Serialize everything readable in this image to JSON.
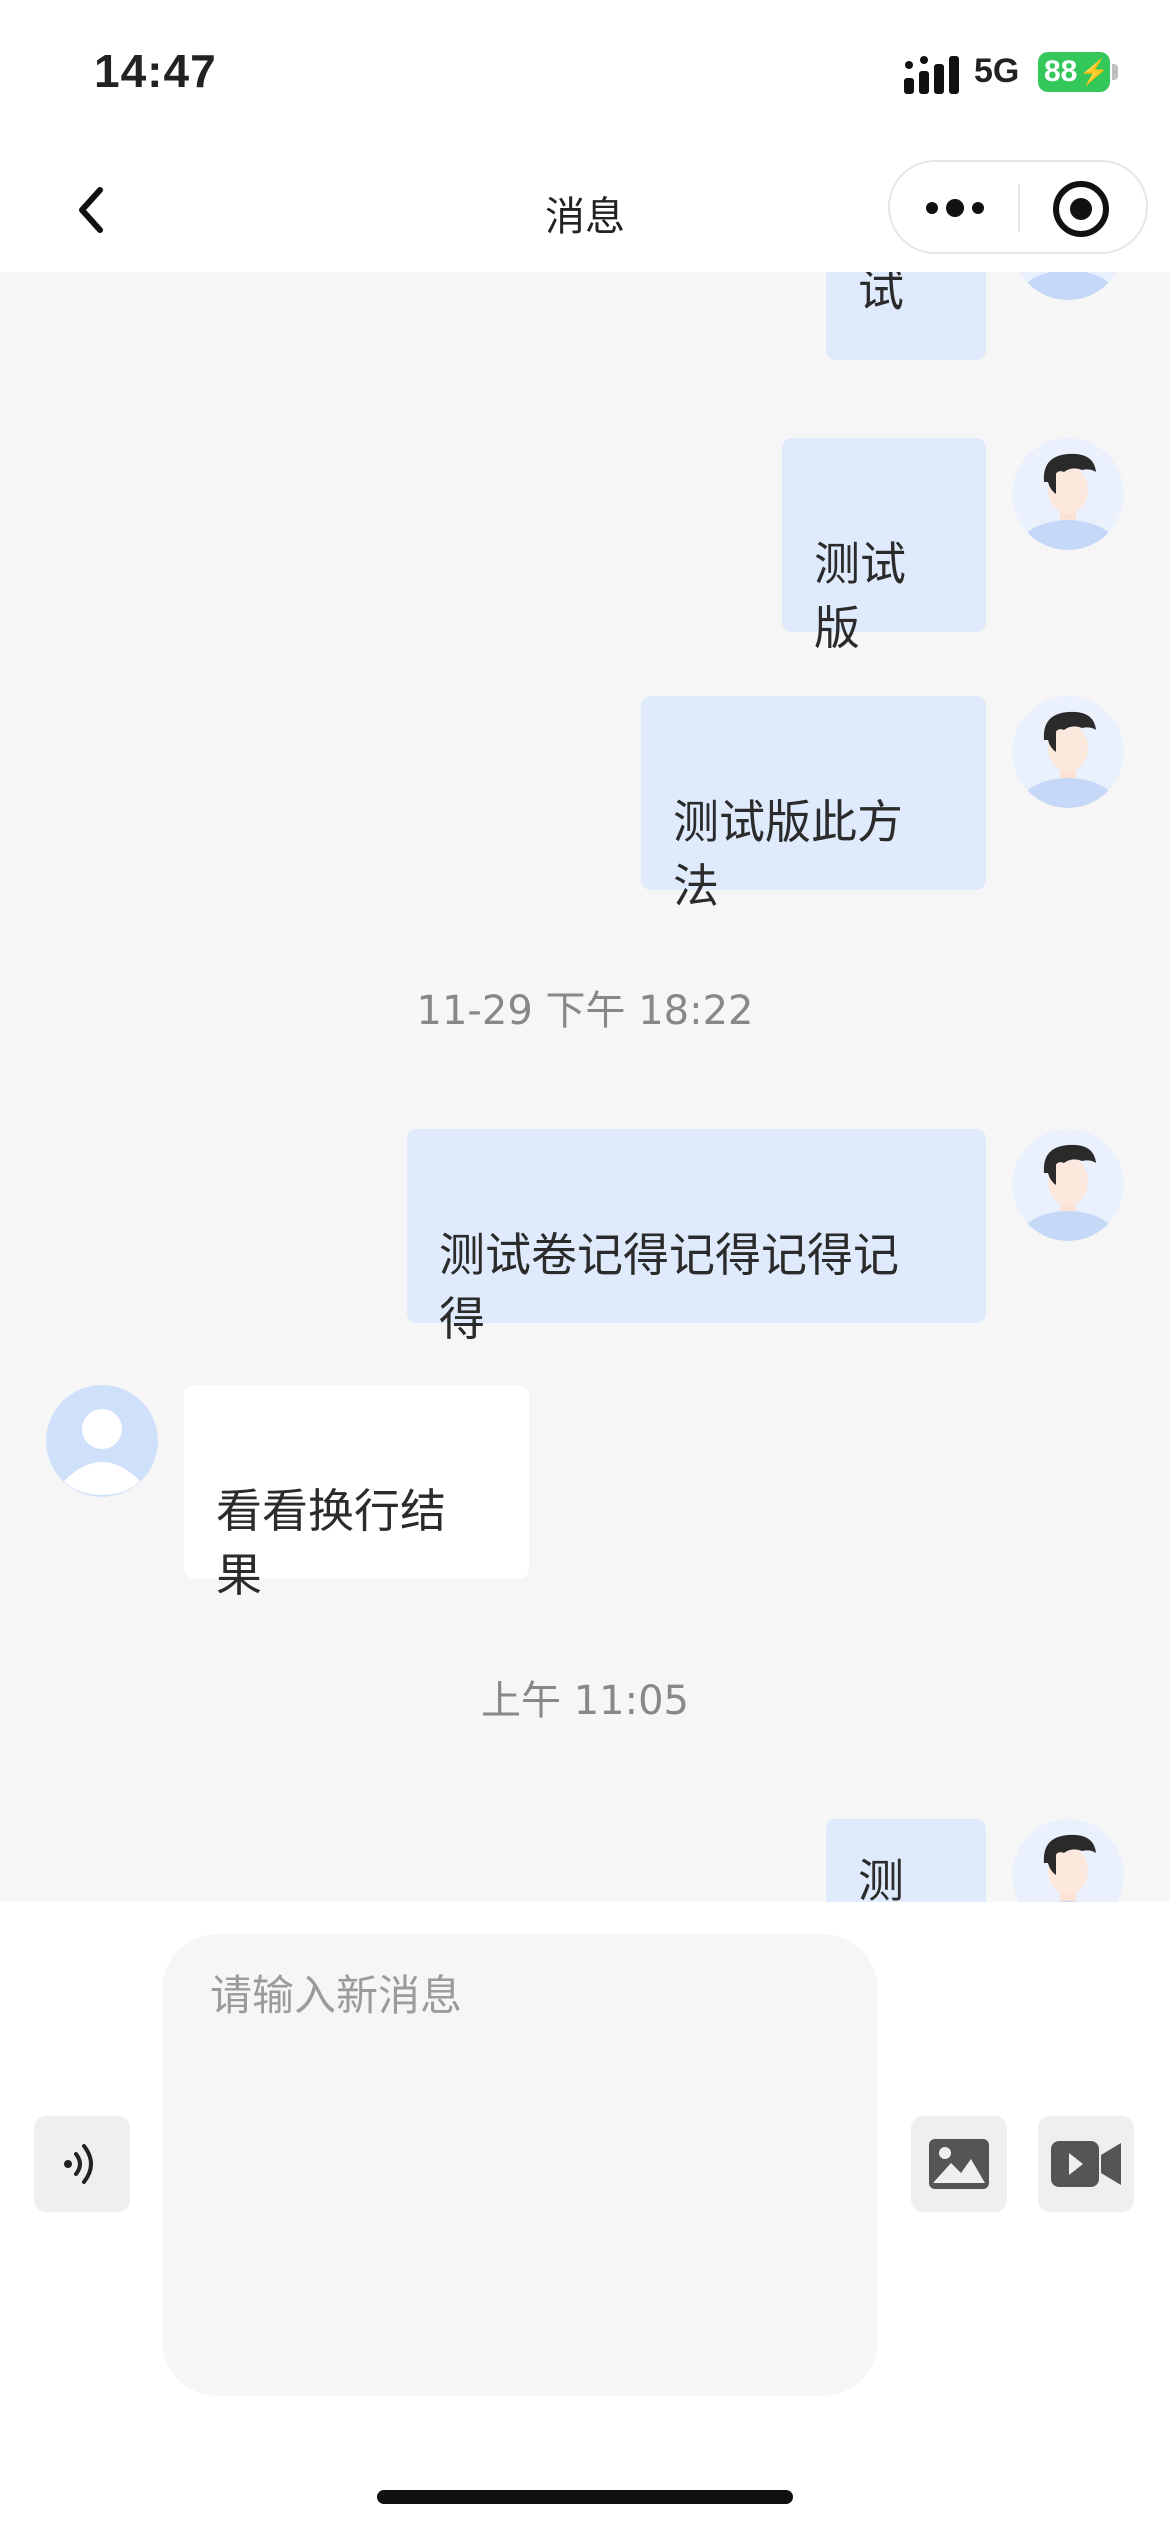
{
  "status_bar": {
    "time": "14:47",
    "network": "5G",
    "battery": "88"
  },
  "nav": {
    "title": "消息"
  },
  "chat": {
    "messages": [
      {
        "side": "me",
        "text": "试"
      },
      {
        "side": "me",
        "text": "测试\n版"
      },
      {
        "side": "me",
        "text": "测试版此方\n法"
      },
      {
        "type": "timestamp",
        "text": "11-29 下午 18:22"
      },
      {
        "side": "me",
        "text": "测试卷记得记得记得记\n得"
      },
      {
        "side": "other",
        "text": "看看换行结\n果"
      },
      {
        "type": "timestamp",
        "text": "上午 11:05"
      },
      {
        "side": "me",
        "text": "测"
      }
    ]
  },
  "composer": {
    "placeholder": "请输入新消息",
    "value": ""
  },
  "colors": {
    "my_bubble": "#dfeafc",
    "other_bubble": "#ffffff",
    "battery": "#34c759",
    "background": "#f6f6f6"
  },
  "icons": [
    "back-icon",
    "more-dots-icon",
    "target-icon",
    "voice-icon",
    "image-icon",
    "video-icon"
  ]
}
